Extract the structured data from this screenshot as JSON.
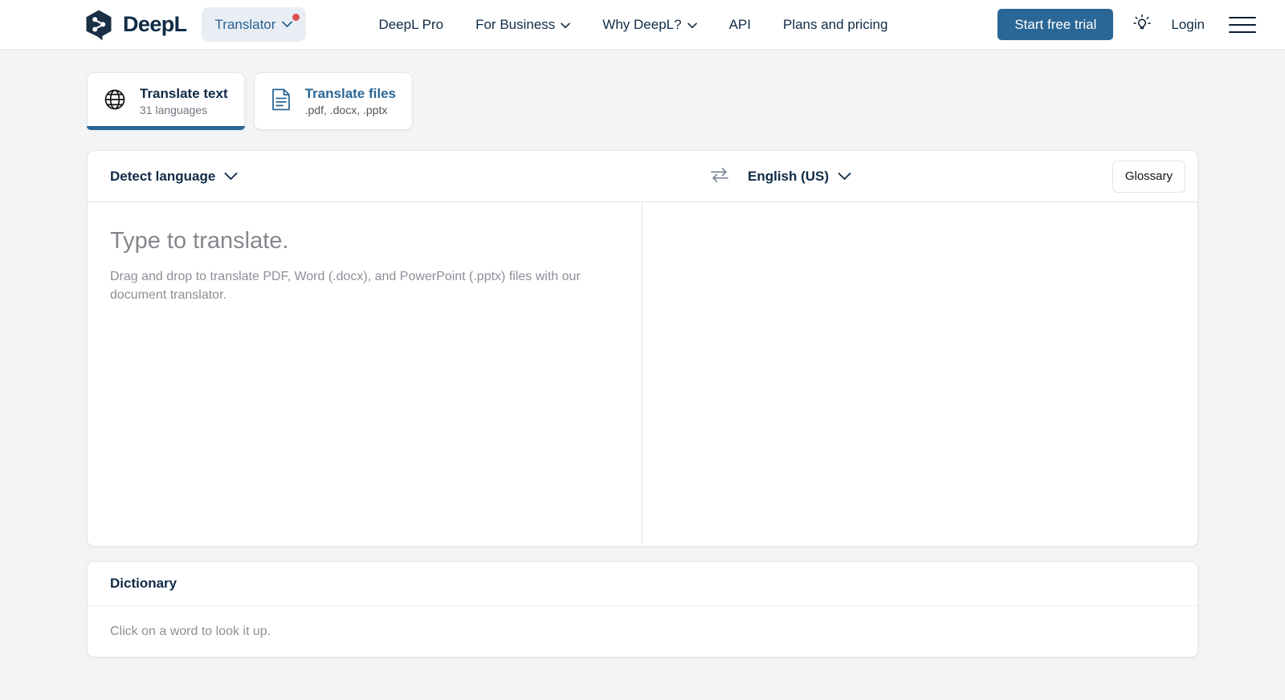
{
  "brand": {
    "name": "DeepL",
    "logo_icon": "deepl-logo-icon"
  },
  "header": {
    "product_switcher": {
      "label": "Translator",
      "icon": "chevron-down-icon",
      "badge_color": "#d9534f"
    },
    "nav": [
      {
        "label": "DeepL Pro",
        "has_chevron": false
      },
      {
        "label": "For Business",
        "has_chevron": true
      },
      {
        "label": "Why DeepL?",
        "has_chevron": true
      },
      {
        "label": "API",
        "has_chevron": false
      },
      {
        "label": "Plans and pricing",
        "has_chevron": false
      }
    ],
    "cta_label": "Start free trial",
    "cta_color": "#2b6796",
    "theme_toggle_icon": "lightbulb-icon",
    "login_label": "Login",
    "menu_icon": "hamburger-menu-icon"
  },
  "tabs": [
    {
      "id": "translate-text",
      "icon": "globe-icon",
      "title": "Translate text",
      "subtitle": "31 languages",
      "active": true
    },
    {
      "id": "translate-files",
      "icon": "document-icon",
      "title": "Translate files",
      "subtitle": ".pdf, .docx, .pptx",
      "active": false
    }
  ],
  "translator": {
    "source_language": "Detect language",
    "target_language": "English (US)",
    "swap_icon": "swap-arrows-icon",
    "chevron_icon": "chevron-down-icon",
    "glossary_label": "Glossary",
    "source_placeholder": "Type to translate.",
    "source_hint": "Drag and drop to translate PDF, Word (.docx), and PowerPoint (.pptx) files with our document translator.",
    "target_text": ""
  },
  "dictionary": {
    "title": "Dictionary",
    "hint": "Click on a word to look it up."
  }
}
